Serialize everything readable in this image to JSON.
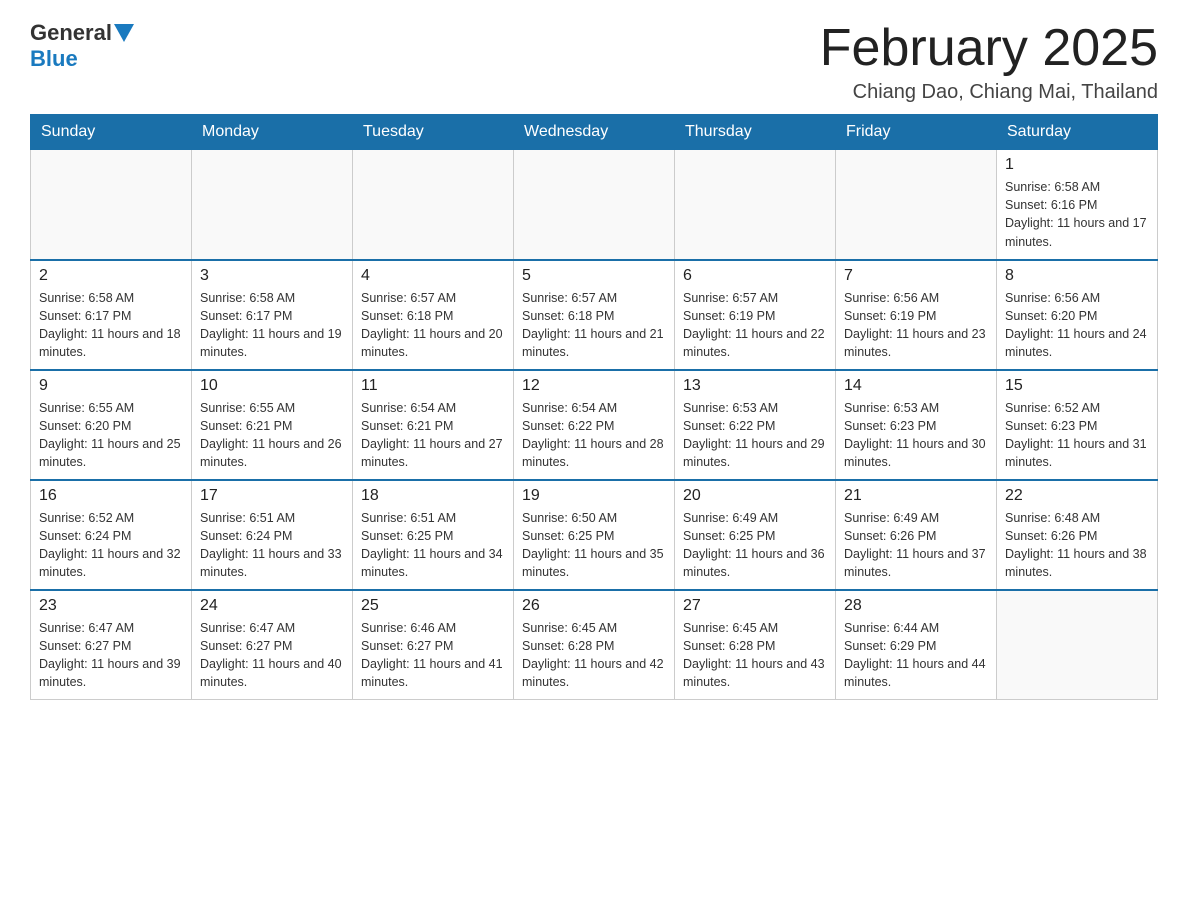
{
  "header": {
    "logo_general": "General",
    "logo_blue": "Blue",
    "month_title": "February 2025",
    "location": "Chiang Dao, Chiang Mai, Thailand"
  },
  "days_of_week": [
    "Sunday",
    "Monday",
    "Tuesday",
    "Wednesday",
    "Thursday",
    "Friday",
    "Saturday"
  ],
  "weeks": [
    [
      {
        "day": "",
        "info": ""
      },
      {
        "day": "",
        "info": ""
      },
      {
        "day": "",
        "info": ""
      },
      {
        "day": "",
        "info": ""
      },
      {
        "day": "",
        "info": ""
      },
      {
        "day": "",
        "info": ""
      },
      {
        "day": "1",
        "info": "Sunrise: 6:58 AM\nSunset: 6:16 PM\nDaylight: 11 hours and 17 minutes."
      }
    ],
    [
      {
        "day": "2",
        "info": "Sunrise: 6:58 AM\nSunset: 6:17 PM\nDaylight: 11 hours and 18 minutes."
      },
      {
        "day": "3",
        "info": "Sunrise: 6:58 AM\nSunset: 6:17 PM\nDaylight: 11 hours and 19 minutes."
      },
      {
        "day": "4",
        "info": "Sunrise: 6:57 AM\nSunset: 6:18 PM\nDaylight: 11 hours and 20 minutes."
      },
      {
        "day": "5",
        "info": "Sunrise: 6:57 AM\nSunset: 6:18 PM\nDaylight: 11 hours and 21 minutes."
      },
      {
        "day": "6",
        "info": "Sunrise: 6:57 AM\nSunset: 6:19 PM\nDaylight: 11 hours and 22 minutes."
      },
      {
        "day": "7",
        "info": "Sunrise: 6:56 AM\nSunset: 6:19 PM\nDaylight: 11 hours and 23 minutes."
      },
      {
        "day": "8",
        "info": "Sunrise: 6:56 AM\nSunset: 6:20 PM\nDaylight: 11 hours and 24 minutes."
      }
    ],
    [
      {
        "day": "9",
        "info": "Sunrise: 6:55 AM\nSunset: 6:20 PM\nDaylight: 11 hours and 25 minutes."
      },
      {
        "day": "10",
        "info": "Sunrise: 6:55 AM\nSunset: 6:21 PM\nDaylight: 11 hours and 26 minutes."
      },
      {
        "day": "11",
        "info": "Sunrise: 6:54 AM\nSunset: 6:21 PM\nDaylight: 11 hours and 27 minutes."
      },
      {
        "day": "12",
        "info": "Sunrise: 6:54 AM\nSunset: 6:22 PM\nDaylight: 11 hours and 28 minutes."
      },
      {
        "day": "13",
        "info": "Sunrise: 6:53 AM\nSunset: 6:22 PM\nDaylight: 11 hours and 29 minutes."
      },
      {
        "day": "14",
        "info": "Sunrise: 6:53 AM\nSunset: 6:23 PM\nDaylight: 11 hours and 30 minutes."
      },
      {
        "day": "15",
        "info": "Sunrise: 6:52 AM\nSunset: 6:23 PM\nDaylight: 11 hours and 31 minutes."
      }
    ],
    [
      {
        "day": "16",
        "info": "Sunrise: 6:52 AM\nSunset: 6:24 PM\nDaylight: 11 hours and 32 minutes."
      },
      {
        "day": "17",
        "info": "Sunrise: 6:51 AM\nSunset: 6:24 PM\nDaylight: 11 hours and 33 minutes."
      },
      {
        "day": "18",
        "info": "Sunrise: 6:51 AM\nSunset: 6:25 PM\nDaylight: 11 hours and 34 minutes."
      },
      {
        "day": "19",
        "info": "Sunrise: 6:50 AM\nSunset: 6:25 PM\nDaylight: 11 hours and 35 minutes."
      },
      {
        "day": "20",
        "info": "Sunrise: 6:49 AM\nSunset: 6:25 PM\nDaylight: 11 hours and 36 minutes."
      },
      {
        "day": "21",
        "info": "Sunrise: 6:49 AM\nSunset: 6:26 PM\nDaylight: 11 hours and 37 minutes."
      },
      {
        "day": "22",
        "info": "Sunrise: 6:48 AM\nSunset: 6:26 PM\nDaylight: 11 hours and 38 minutes."
      }
    ],
    [
      {
        "day": "23",
        "info": "Sunrise: 6:47 AM\nSunset: 6:27 PM\nDaylight: 11 hours and 39 minutes."
      },
      {
        "day": "24",
        "info": "Sunrise: 6:47 AM\nSunset: 6:27 PM\nDaylight: 11 hours and 40 minutes."
      },
      {
        "day": "25",
        "info": "Sunrise: 6:46 AM\nSunset: 6:27 PM\nDaylight: 11 hours and 41 minutes."
      },
      {
        "day": "26",
        "info": "Sunrise: 6:45 AM\nSunset: 6:28 PM\nDaylight: 11 hours and 42 minutes."
      },
      {
        "day": "27",
        "info": "Sunrise: 6:45 AM\nSunset: 6:28 PM\nDaylight: 11 hours and 43 minutes."
      },
      {
        "day": "28",
        "info": "Sunrise: 6:44 AM\nSunset: 6:29 PM\nDaylight: 11 hours and 44 minutes."
      },
      {
        "day": "",
        "info": ""
      }
    ]
  ]
}
